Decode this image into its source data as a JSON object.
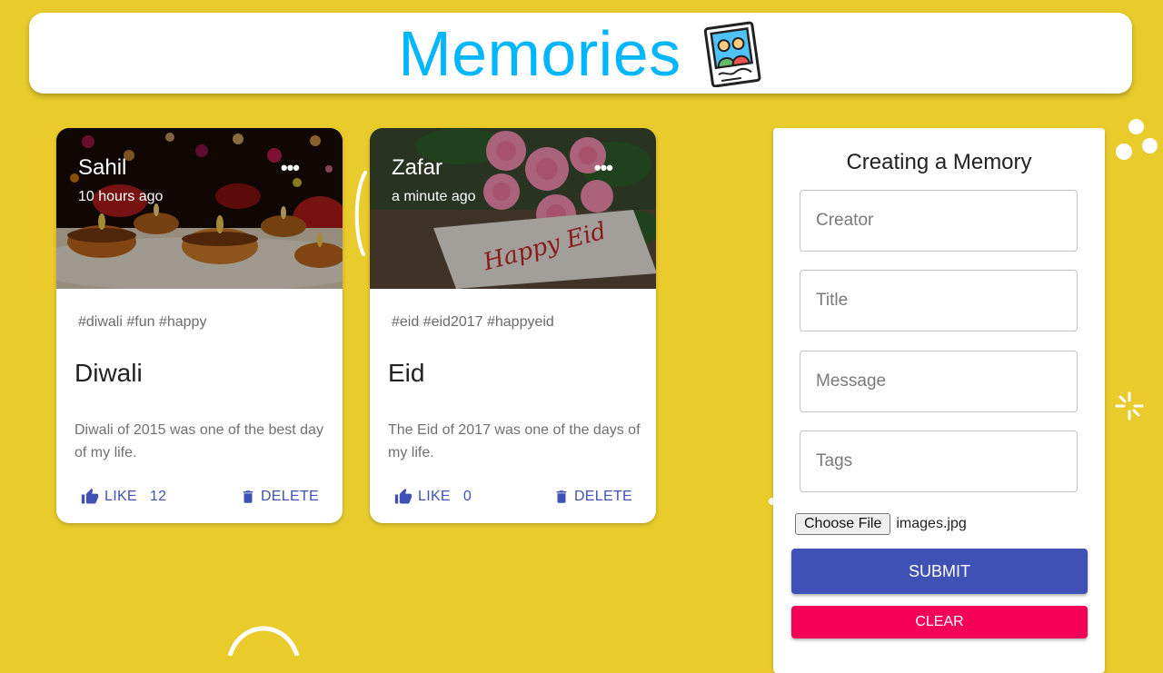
{
  "app": {
    "title": "Memories",
    "logo_icon": "photo-icon",
    "background_color": "#e9cb2c",
    "accent_color": "#00b7ff"
  },
  "posts": [
    {
      "creator": "Sahil",
      "time": "10 hours ago",
      "tags": "#diwali #fun #happy",
      "title": "Diwali",
      "message": "Diwali of 2015 was one of the best day of my life.",
      "like_label": "LIKE",
      "like_count": "12",
      "delete_label": "DELETE",
      "image_icon": "diya-lamps-image"
    },
    {
      "creator": "Zafar",
      "time": "a minute ago",
      "tags": "#eid #eid2017 #happyeid",
      "title": "Eid",
      "message": "The Eid of 2017 was one of the days of my life.",
      "like_label": "LIKE",
      "like_count": "0",
      "delete_label": "DELETE",
      "image_icon": "roses-happy-eid-card-image",
      "image_caption": "Happy Eid"
    }
  ],
  "form": {
    "title": "Creating a Memory",
    "creator_placeholder": "Creator",
    "title_placeholder": "Title",
    "message_placeholder": "Message",
    "tags_placeholder": "Tags",
    "file_button": "Choose File",
    "file_name": "images.jpg",
    "submit_label": "SUBMIT",
    "clear_label": "CLEAR",
    "submit_color": "#3f51b5",
    "clear_color": "#f50057"
  }
}
